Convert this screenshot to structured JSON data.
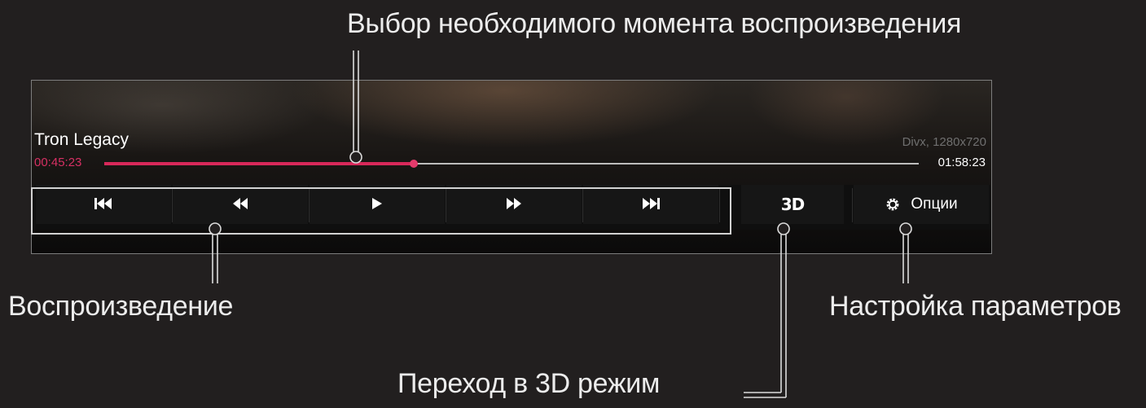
{
  "annotations": {
    "seek": "Выбор необходимого момента воспроизведения",
    "playback": "Воспроизведение",
    "mode_3d": "Переход в 3D режим",
    "settings": "Настройка параметров"
  },
  "player": {
    "title": "Tron Legacy",
    "file_info": "Divx, 1280x720",
    "elapsed": "00:45:23",
    "duration": "01:58:23",
    "progress": 0.38
  },
  "controls": {
    "icons": [
      "skip-previous-icon",
      "rewind-icon",
      "play-icon",
      "fast-forward-icon",
      "skip-next-icon",
      "3d-icon",
      "gear-icon"
    ],
    "mode_3d_label": "3D",
    "options_label": "Опции"
  },
  "colors": {
    "background": "#221f1f",
    "progress": "#d8285a",
    "elapsed_text": "#d63063",
    "file_info_text": "#6f6f6f"
  }
}
